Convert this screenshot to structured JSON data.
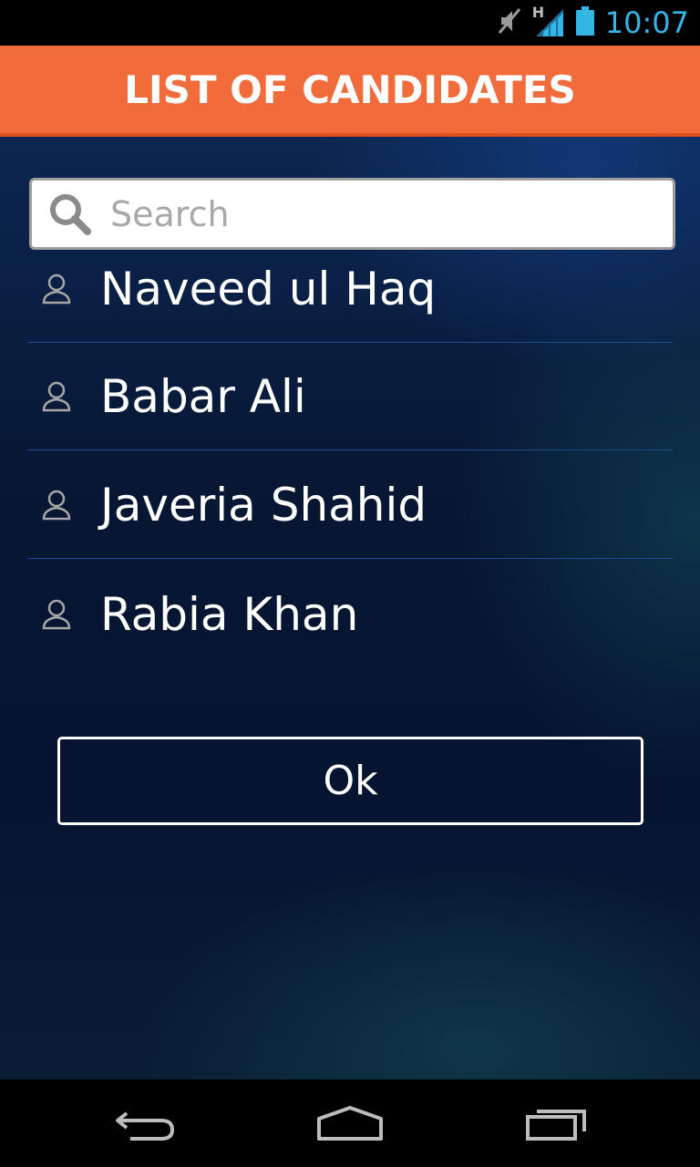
{
  "status_bar": {
    "time": "10:07",
    "network_label": "H",
    "icons": [
      "mute-icon",
      "signal-icon",
      "battery-icon"
    ],
    "time_color": "#33b5e5"
  },
  "header": {
    "title": "LIST OF CANDIDATES",
    "color": "#f26b3a"
  },
  "search": {
    "placeholder": "Search",
    "value": ""
  },
  "candidates": [
    {
      "name": "Naveed ul Haq"
    },
    {
      "name": "Babar Ali"
    },
    {
      "name": "Javeria Shahid"
    },
    {
      "name": "Rabia Khan"
    }
  ],
  "ok_button": {
    "label": "Ok"
  },
  "nav_bar": {
    "icons": [
      "back-icon",
      "home-icon",
      "recents-icon"
    ]
  }
}
